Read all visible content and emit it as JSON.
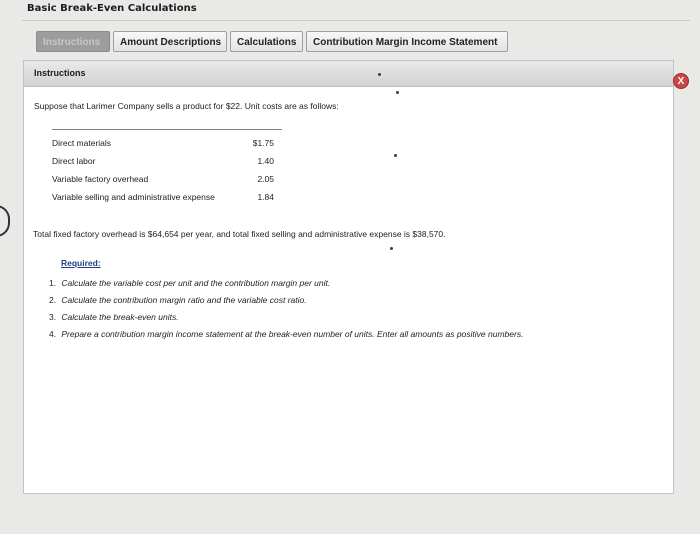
{
  "window": {
    "title": "Basic Break-Even Calculations"
  },
  "tabs": [
    {
      "label": "Instructions",
      "active": true
    },
    {
      "label": "Amount Descriptions",
      "active": false
    },
    {
      "label": "Calculations",
      "active": false
    },
    {
      "label": "Contribution Margin Income Statement",
      "active": false
    }
  ],
  "panel": {
    "header": "Instructions",
    "close_label": "X",
    "intro": "Suppose that Larimer Company sells a product for $22. Unit costs are as follows:",
    "costs": [
      {
        "label": "Direct materials",
        "amount": "$1.75"
      },
      {
        "label": "Direct labor",
        "amount": "1.40"
      },
      {
        "label": "Variable factory overhead",
        "amount": "2.05"
      },
      {
        "label": "Variable selling and administrative expense",
        "amount": "1.84"
      }
    ],
    "overhead_text": "Total fixed factory overhead is $64,654 per year, and total fixed selling and administrative expense is $38,570.",
    "required_label": "Required:",
    "requirements": [
      {
        "num": "1.",
        "text": "Calculate the variable cost per unit and the contribution margin per unit."
      },
      {
        "num": "2.",
        "text": "Calculate the contribution margin ratio and the variable cost ratio."
      },
      {
        "num": "3.",
        "text": "Calculate the break-even units."
      },
      {
        "num": "4.",
        "text": "Prepare a contribution margin income statement at the break-even number of units. Enter all amounts as positive numbers."
      }
    ]
  },
  "colors": {
    "accent_link": "#1f3f86",
    "close_button": "#c84646"
  }
}
